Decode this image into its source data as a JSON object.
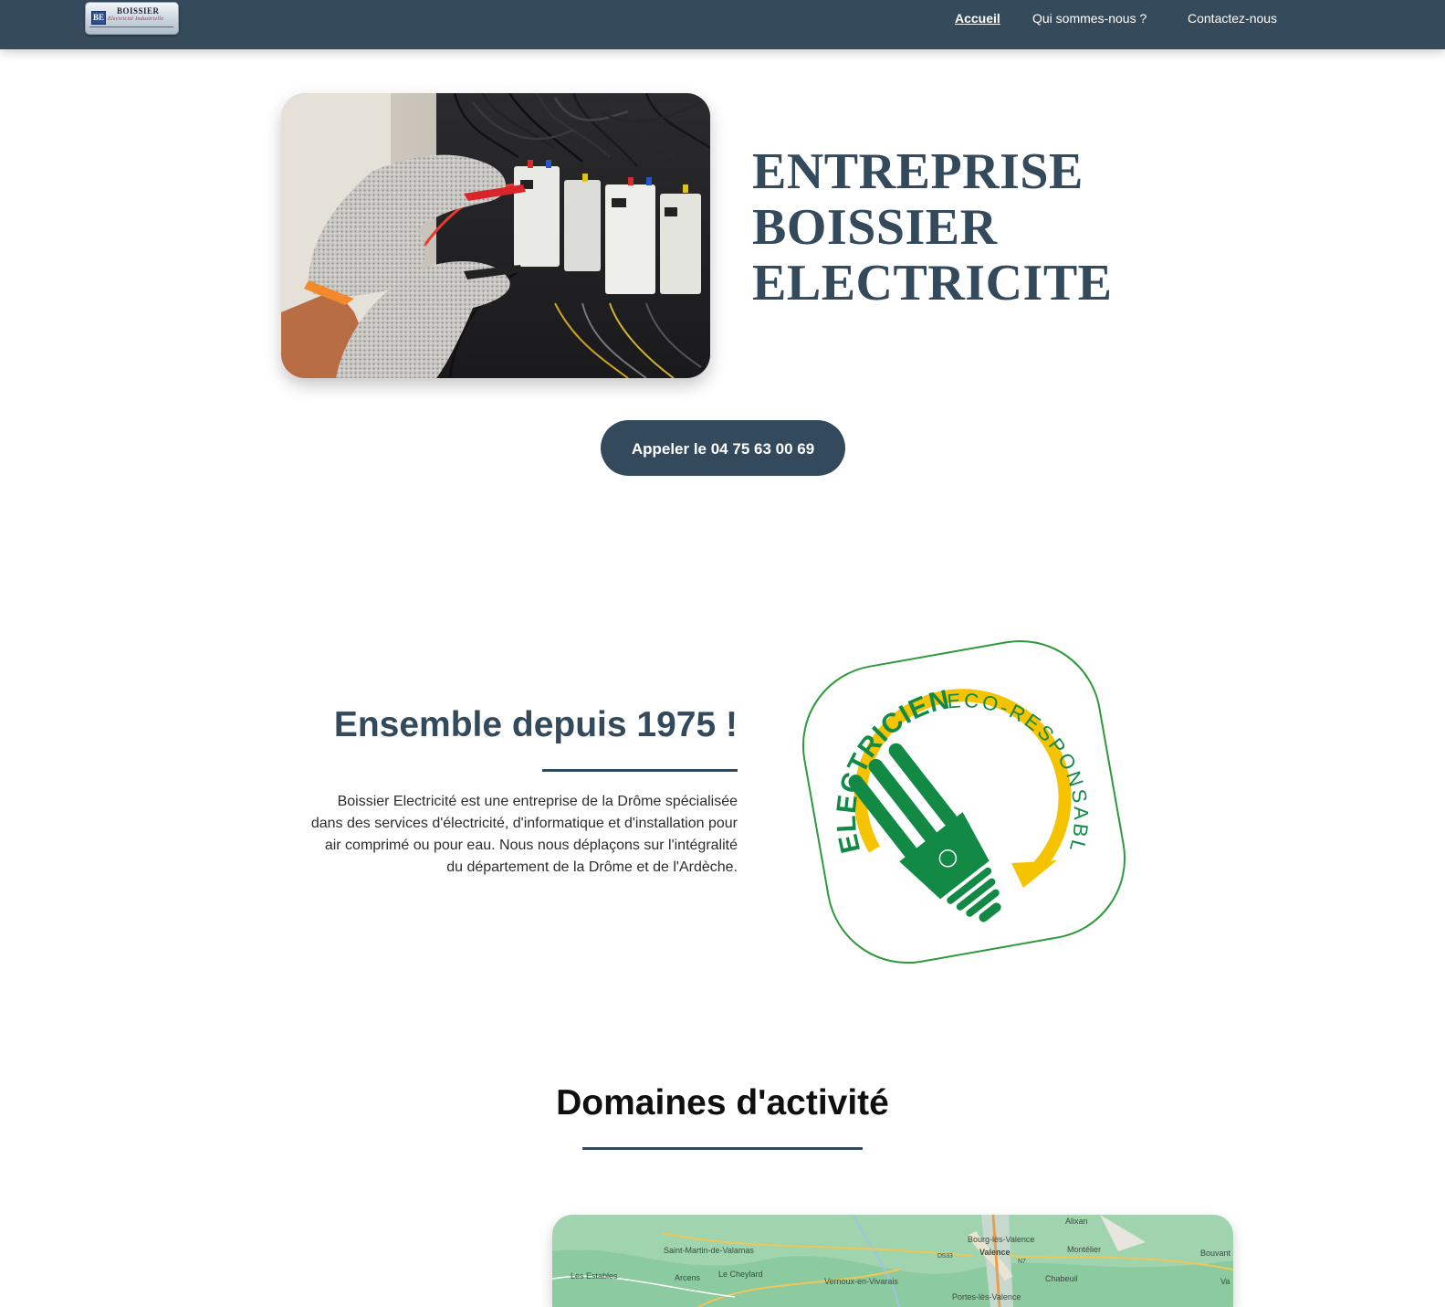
{
  "header": {
    "logo": {
      "mark": "BE",
      "name": "BOISSIER",
      "subtitle": "Electricité Industrielle"
    },
    "nav": [
      {
        "label": "Accueil",
        "active": true
      },
      {
        "label": "Qui sommes-nous ?",
        "active": false
      },
      {
        "label": "Contactez-nous",
        "active": false
      }
    ],
    "bar_color": "#354a5a"
  },
  "hero": {
    "title_lines": [
      "ENTREPRISE",
      "BOISSIER",
      "ELECTRICITE"
    ],
    "call_button": "Appeler le 04 75 63 00 69",
    "accent_color": "#33495c"
  },
  "about": {
    "title": "Ensemble depuis 1975 !",
    "text": "Boissier Electricité est une entreprise de la Drôme spécialisée dans des services d'électricité, d'informatique et d'installation pour air comprimé ou pour eau. Nous nous déplaçons sur l'intégralité du département de la Drôme et de l'Ardèche.",
    "badge": {
      "word1": "ELECTRICIEN",
      "word2": "ECO-RESPONSABLE",
      "icon": "eco-bulb-icon",
      "green": "#128a45",
      "yellow": "#f6c300"
    }
  },
  "domaines": {
    "title": "Domaines d'activité",
    "map_labels": [
      "Alixan",
      "Bourg-lès-Valence",
      "Valence",
      "Montélier",
      "Bouvant",
      "Saint-Martin-de-Valamas",
      "Les Estables",
      "Arcens",
      "Le Cheylard",
      "Vernoux-en-Vivarais",
      "Chabeuil",
      "Portes-lès-Valence",
      "D533",
      "N7",
      "Va"
    ]
  }
}
